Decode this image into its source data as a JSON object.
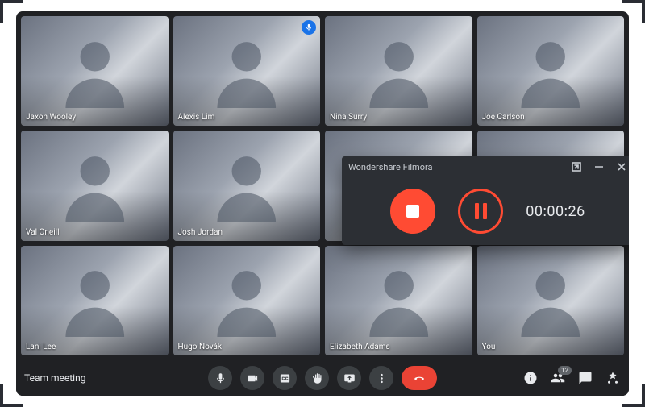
{
  "meeting": {
    "name": "Team meeting",
    "participant_count_badge": "12"
  },
  "participants": [
    {
      "name": "Jaxon Wooley",
      "speaking": false
    },
    {
      "name": "Alexis Lim",
      "speaking": true
    },
    {
      "name": "Nina Surry",
      "speaking": false
    },
    {
      "name": "Joe Carlson",
      "speaking": false
    },
    {
      "name": "Val Oneill",
      "speaking": false
    },
    {
      "name": "Josh Jordan",
      "speaking": false
    },
    {
      "name": "",
      "speaking": false
    },
    {
      "name": "",
      "speaking": false
    },
    {
      "name": "Lani Lee",
      "speaking": false
    },
    {
      "name": "Hugo Novák",
      "speaking": false
    },
    {
      "name": "Elizabeth Adams",
      "speaking": false
    },
    {
      "name": "You",
      "speaking": false
    }
  ],
  "controls": {
    "mic": "mic-icon",
    "camera": "camera-icon",
    "cc": "captions-icon",
    "raise_hand": "raise-hand-icon",
    "present": "present-screen-icon",
    "more": "more-options-icon",
    "hangup": "hangup-icon",
    "info": "info-icon",
    "people": "people-icon",
    "chat": "chat-icon",
    "activities": "activities-icon"
  },
  "recorder": {
    "title": "Wondershare Filmora",
    "elapsed": "00:00:26",
    "state": "recording"
  },
  "colors": {
    "accent": "#ff4b33",
    "hangup": "#ea4335",
    "speaking": "#1a73e8",
    "surface": "#202124"
  }
}
